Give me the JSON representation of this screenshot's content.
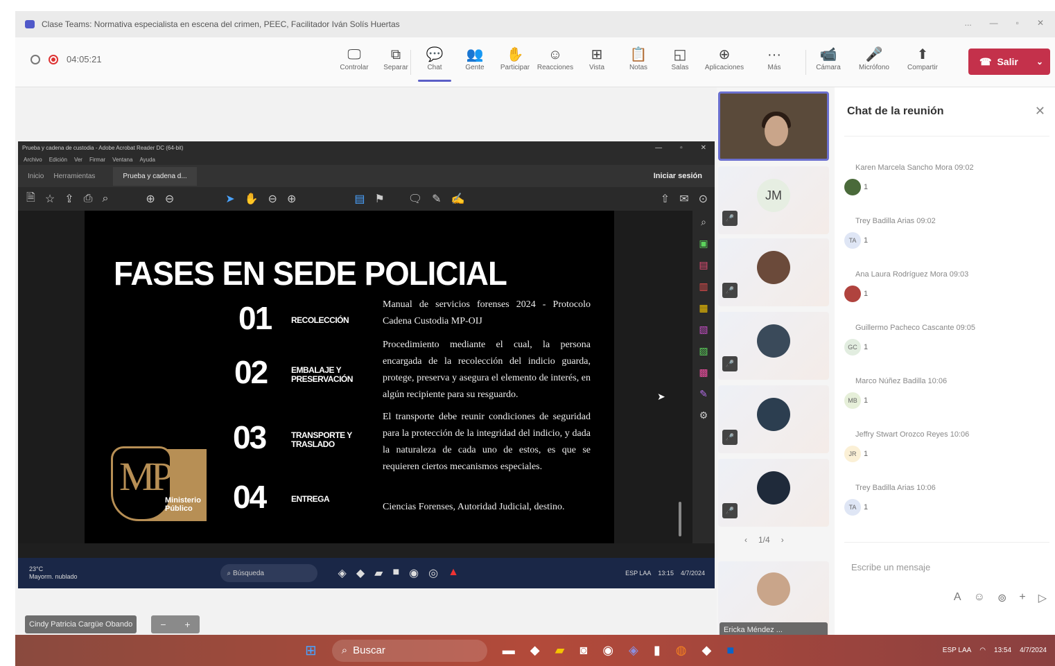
{
  "window": {
    "title": "Clase Teams: Normativa especialista en escena del crimen, PEEC, Facilitador Iván Solís Huertas",
    "controls": [
      "...",
      "—",
      "▫",
      "✕"
    ]
  },
  "meeting": {
    "timer": "04:05:21"
  },
  "toolbar": [
    {
      "icon": "🖵",
      "label": "Controlar"
    },
    {
      "icon": "⧉",
      "label": "Separar"
    },
    {
      "icon": "💬",
      "label": "Chat"
    },
    {
      "icon": "👥",
      "label": "Gente"
    },
    {
      "icon": "✋",
      "label": "Participar"
    },
    {
      "icon": "☺",
      "label": "Reacciones"
    },
    {
      "icon": "⊞",
      "label": "Vista"
    },
    {
      "icon": "📋",
      "label": "Notas"
    },
    {
      "icon": "◱",
      "label": "Salas"
    },
    {
      "icon": "⊕",
      "label": "Aplicaciones"
    },
    {
      "icon": "···",
      "label": "Más"
    },
    {
      "icon": "📹",
      "label": "Cámara"
    },
    {
      "icon": "🎤",
      "label": "Micrófono"
    },
    {
      "icon": "⬆",
      "label": "Compartir"
    }
  ],
  "leave_button": {
    "label": "Salir",
    "icon": "☎",
    "dropdown": "⌄"
  },
  "shared": {
    "app_title": "Prueba y cadena de custodia - Adobe Acrobat Reader DC (64-bit)",
    "menu": [
      "Archivo",
      "Edición",
      "Ver",
      "Firmar",
      "Ventana",
      "Ayuda"
    ],
    "tabs": {
      "home": "Inicio",
      "tools": "Herramientas",
      "doc": "Prueba y cadena d...",
      "login": "Iniciar sesión"
    },
    "slide": {
      "title": "FASES EN SEDE POLICIAL",
      "phases": [
        {
          "num": "01",
          "label": "RECOLECCIÓN"
        },
        {
          "num": "02",
          "label": "EMBALAJE Y PRESERVACIÓN"
        },
        {
          "num": "03",
          "label": "TRANSPORTE Y TRASLADO"
        },
        {
          "num": "04",
          "label": "ENTREGA"
        }
      ],
      "paragraphs": [
        "Manual de servicios forenses 2024 - Protocolo Cadena Custodia MP-OIJ",
        "Procedimiento mediante el cual, la persona encargada de la recolección del indicio guarda, protege, preserva y asegura el elemento de interés, en algún recipiente para su resguardo.",
        "El transporte debe reunir condiciones de seguridad para la protección de la integridad del indicio, y dada la naturaleza de cada uno de estos, es que se requieren ciertos mecanismos especiales.",
        "Ciencias Forenses, Autoridad Judicial, destino."
      ],
      "logo": {
        "letters": "MP",
        "text": "Ministerio Público"
      }
    },
    "taskbar": {
      "weather_temp": "23°C",
      "weather_desc": "Mayorm. nublado",
      "search": "Búsqueda",
      "lang": "ESP LAA",
      "time": "13:15",
      "date": "4/7/2024"
    }
  },
  "presenter": {
    "name": "Cindy Patricia Cargüe Obando",
    "zoom_out": "−",
    "zoom_in": "+"
  },
  "gallery": {
    "tiles": [
      {
        "initials": "JM"
      }
    ],
    "pager": {
      "prev": "‹",
      "text": "1/4",
      "next": "›"
    },
    "bottom_name": "Ericka Méndez ..."
  },
  "chat": {
    "title": "Chat de la reunión",
    "messages": [
      {
        "meta": "Karen Marcela Sancho Mora  09:02",
        "badge": "",
        "count": "1",
        "color": "#4a6a3a"
      },
      {
        "meta": "Trey Badilla Arias  09:02",
        "badge": "TA",
        "count": "1",
        "color": "#dfe6f5"
      },
      {
        "meta": "Ana Laura Rodríguez Mora  09:03",
        "badge": "",
        "count": "1",
        "color": "#b0433e"
      },
      {
        "meta": "Guillermo Pacheco Cascante  09:05",
        "badge": "GC",
        "count": "1",
        "color": "#e2ede0"
      },
      {
        "meta": "Marco Núñez Badilla  10:06",
        "badge": "MB",
        "count": "1",
        "color": "#e6efd9"
      },
      {
        "meta": "Jeffry Stwart Orozco Reyes  10:06",
        "badge": "JR",
        "count": "1",
        "color": "#fbf0d6"
      },
      {
        "meta": "Trey Badilla Arias  10:06",
        "badge": "TA",
        "count": "1",
        "color": "#dfe6f5"
      }
    ],
    "compose_placeholder": "Escribe un mensaje"
  },
  "win_taskbar": {
    "search": "Buscar",
    "lang": "ESP LAA",
    "time": "13:54",
    "date": "4/7/2024"
  }
}
